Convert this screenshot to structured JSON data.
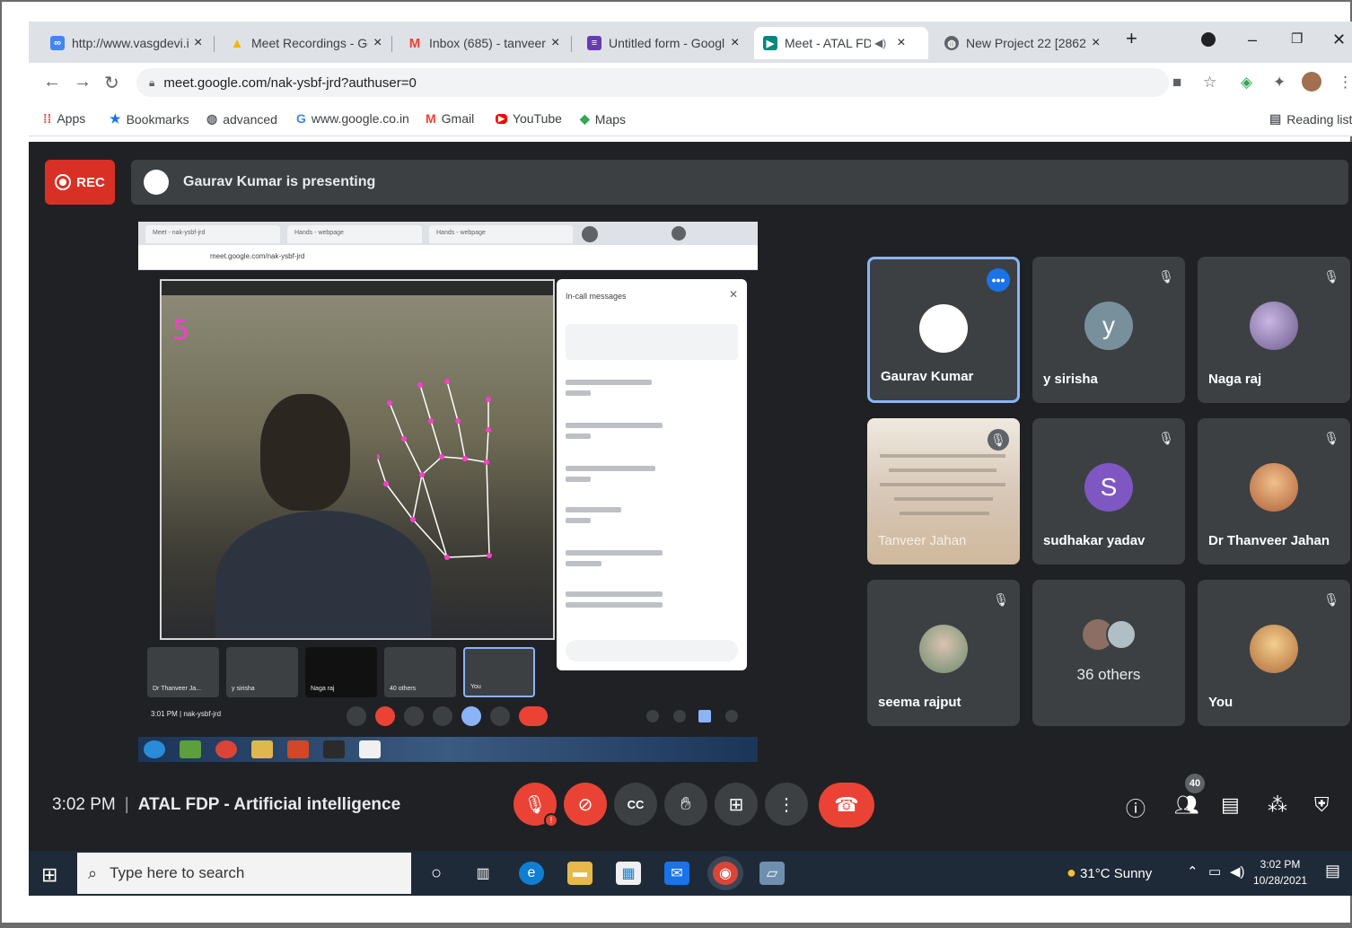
{
  "browser": {
    "tabs": [
      {
        "title": "http://www.vasgdevi.i",
        "favicon": "link-icon",
        "color": "#4285f4"
      },
      {
        "title": "Meet Recordings - Go",
        "favicon": "drive-icon",
        "color": "#f4b400"
      },
      {
        "title": "Inbox (685) - tanveer",
        "favicon": "gmail-icon",
        "color": "#ea4335"
      },
      {
        "title": "Untitled form - Googl",
        "favicon": "forms-icon",
        "color": "#673ab7"
      },
      {
        "title": "Meet - ATAL FDP",
        "favicon": "meet-icon",
        "color": "#00897b",
        "active": true
      },
      {
        "title": "New Project 22 [2862",
        "favicon": "web-icon",
        "color": "#5f6368"
      }
    ],
    "url": "meet.google.com/nak-ysbf-jrd?authuser=0",
    "bookmarks": [
      {
        "label": "Apps",
        "icon": "apps-grid-icon"
      },
      {
        "label": "Bookmarks",
        "icon": "star-icon"
      },
      {
        "label": "advanced",
        "icon": "globe-icon"
      },
      {
        "label": "www.google.co.in",
        "icon": "google-icon"
      },
      {
        "label": "Gmail",
        "icon": "gmail-icon"
      },
      {
        "label": "YouTube",
        "icon": "youtube-icon"
      },
      {
        "label": "Maps",
        "icon": "maps-icon"
      }
    ],
    "reading_list": "Reading list"
  },
  "meet": {
    "rec_label": "REC",
    "presenting_text": "Gaurav Kumar is presenting",
    "shared_screen": {
      "gesture_count": "5",
      "chat_title": "In-call messages",
      "time": "3:01 PM",
      "meeting_code": "nak-ysbf-jrd",
      "thumb_labels": [
        "Dr Thanveer Ja...",
        "y sirisha",
        "Naga raj",
        "40 others",
        "You"
      ]
    },
    "participants": [
      {
        "name": "Gaurav Kumar",
        "initial": "",
        "avatar_color": "#ffffff",
        "muted": false,
        "active": true
      },
      {
        "name": "y sirisha",
        "initial": "y",
        "avatar_color": "#78909c",
        "muted": true
      },
      {
        "name": "Naga raj",
        "initial": "",
        "avatar_color": "#8e7cc3",
        "muted": true
      },
      {
        "name": "Tanveer Jahan",
        "initial": "",
        "avatar_color": "#d8c8b8",
        "muted": true
      },
      {
        "name": "sudhakar yadav",
        "initial": "S",
        "avatar_color": "#7e57c2",
        "muted": true
      },
      {
        "name": "Dr Thanveer Jahan",
        "initial": "",
        "avatar_color": "#e6a66b",
        "muted": true
      },
      {
        "name": "seema rajput",
        "initial": "",
        "avatar_color": "#9fb8a0",
        "muted": true
      },
      {
        "name": "36 others",
        "initial": "",
        "avatar_color": "#8d6e63",
        "muted": false
      },
      {
        "name": "You",
        "initial": "",
        "avatar_color": "#e0a060",
        "muted": true
      }
    ],
    "time": "3:02 PM",
    "meeting_title": "ATAL FDP - Artificial intelligence",
    "participant_count": "40"
  },
  "taskbar": {
    "search_placeholder": "Type here to search",
    "weather": "31°C  Sunny",
    "time": "3:02 PM",
    "date": "10/28/2021"
  }
}
